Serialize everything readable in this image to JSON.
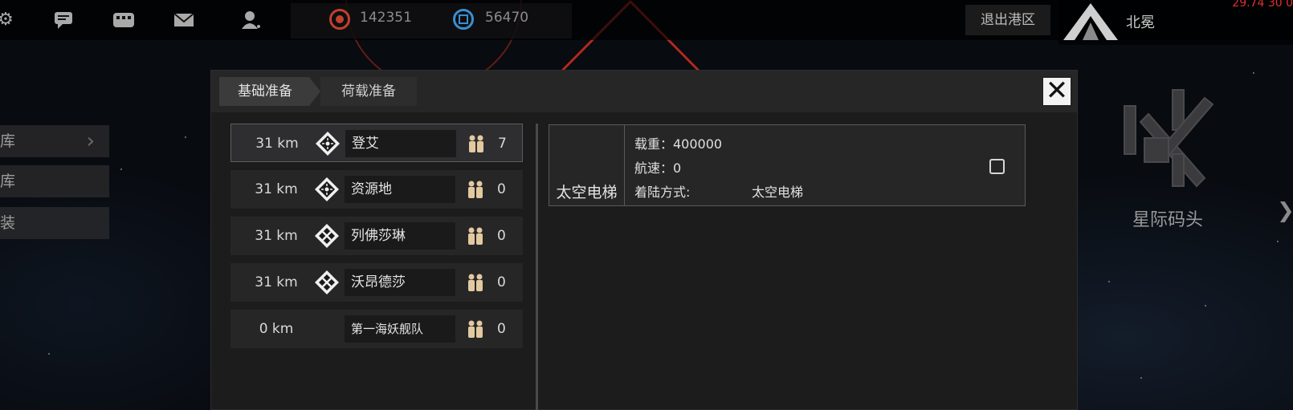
{
  "topbar": {
    "icons": [
      "gear-icon",
      "chat-icon",
      "messages-icon",
      "mail-icon",
      "profile-icon"
    ],
    "resource_1": {
      "value": "142351",
      "color": "#c0412c"
    },
    "resource_2": {
      "value": "56470",
      "color": "#3a8fd0"
    },
    "exit_label": "退出港区",
    "player_name": "北冕",
    "coord_text": "29.74 30 0"
  },
  "left_menu": {
    "items": [
      {
        "label": "库"
      },
      {
        "label": "库"
      },
      {
        "label": "装"
      }
    ]
  },
  "right_side": {
    "dock_label": "星际码头",
    "arrow": "❯"
  },
  "dialog": {
    "tabs": [
      {
        "label": "基础准备",
        "active": true
      },
      {
        "label": "荷载准备",
        "active": false
      }
    ],
    "close_label": "✕",
    "destinations": [
      {
        "distance": "31 km",
        "name": "登艾",
        "count": "7",
        "icon": "planet-diamond-icon",
        "selected": true
      },
      {
        "distance": "31 km",
        "name": "资源地",
        "count": "0",
        "icon": "planet-diamond-icon",
        "selected": false
      },
      {
        "distance": "31 km",
        "name": "列佛莎琳",
        "count": "0",
        "icon": "planet-diamond-x-icon",
        "selected": false
      },
      {
        "distance": "31 km",
        "name": "沃昂德莎",
        "count": "0",
        "icon": "planet-diamond-x-icon",
        "selected": false
      },
      {
        "distance": "0 km",
        "name": "第一海妖舰队",
        "count": "0",
        "icon": "",
        "selected": false
      }
    ],
    "ship": {
      "name": "太空电梯",
      "load_label": "载重：400000",
      "speed_label": "航速：0",
      "landing_label": "着陆方式:",
      "landing_value": "太空电梯",
      "checked": false
    }
  },
  "colors": {
    "accent_red": "#e03030",
    "people_icon": "#e2c9a0"
  }
}
